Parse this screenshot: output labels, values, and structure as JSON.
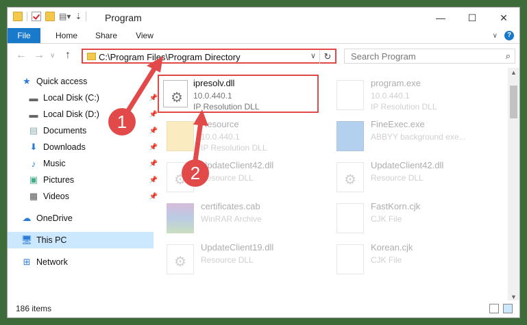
{
  "window": {
    "title": "Program",
    "controls": {
      "minimize": "—",
      "maximize": "☐",
      "close": "✕"
    }
  },
  "ribbon": {
    "tabs": [
      "File",
      "Home",
      "Share",
      "View"
    ]
  },
  "nav": {
    "address": "C:\\Program Files\\Program Directory",
    "search_placeholder": "Search Program"
  },
  "sidebar": {
    "items": [
      {
        "label": "Quick access",
        "icon": "star-icon"
      },
      {
        "label": "Local Disk (C:)",
        "icon": "drive-icon"
      },
      {
        "label": "Local Disk (D:)",
        "icon": "drive-icon"
      },
      {
        "label": "Documents",
        "icon": "documents-icon"
      },
      {
        "label": "Downloads",
        "icon": "download-icon"
      },
      {
        "label": "Music",
        "icon": "music-icon"
      },
      {
        "label": "Pictures",
        "icon": "pictures-icon"
      },
      {
        "label": "Videos",
        "icon": "videos-icon"
      },
      {
        "label": "OneDrive",
        "icon": "cloud-icon"
      },
      {
        "label": "This PC",
        "icon": "computer-icon"
      },
      {
        "label": "Network",
        "icon": "network-icon"
      }
    ]
  },
  "files": [
    {
      "name": "ipresolv.dll",
      "line2": "10.0.440.1",
      "line3": "IP Resolution DLL"
    },
    {
      "name": "program.exe",
      "line2": "10.0.440.1",
      "line3": "IP Resolution DLL"
    },
    {
      "name": "Resource",
      "line2": "10.0.440.1",
      "line3": "IP Resolution DLL"
    },
    {
      "name": "FineExec.exe",
      "line2": "ABBYY background exe...",
      "line3": ""
    },
    {
      "name": "UpdateClient42.dll",
      "line2": "Resource DLL",
      "line3": ""
    },
    {
      "name": "UpdateClient42.dll",
      "line2": "Resource DLL",
      "line3": ""
    },
    {
      "name": "certificates.cab",
      "line2": "WinRAR Archive",
      "line3": ""
    },
    {
      "name": "FastKorn.cjk",
      "line2": "CJK File",
      "line3": ""
    },
    {
      "name": "UpdateClient19.dll",
      "line2": "Resource DLL",
      "line3": ""
    },
    {
      "name": "Korean.cjk",
      "line2": "CJK File",
      "line3": ""
    }
  ],
  "status": {
    "items": "186 items"
  },
  "annotations": {
    "badge1": "1",
    "badge2": "2"
  },
  "colors": {
    "accent": "#1979ca",
    "highlight": "#e04848",
    "selected": "#cce8ff"
  }
}
